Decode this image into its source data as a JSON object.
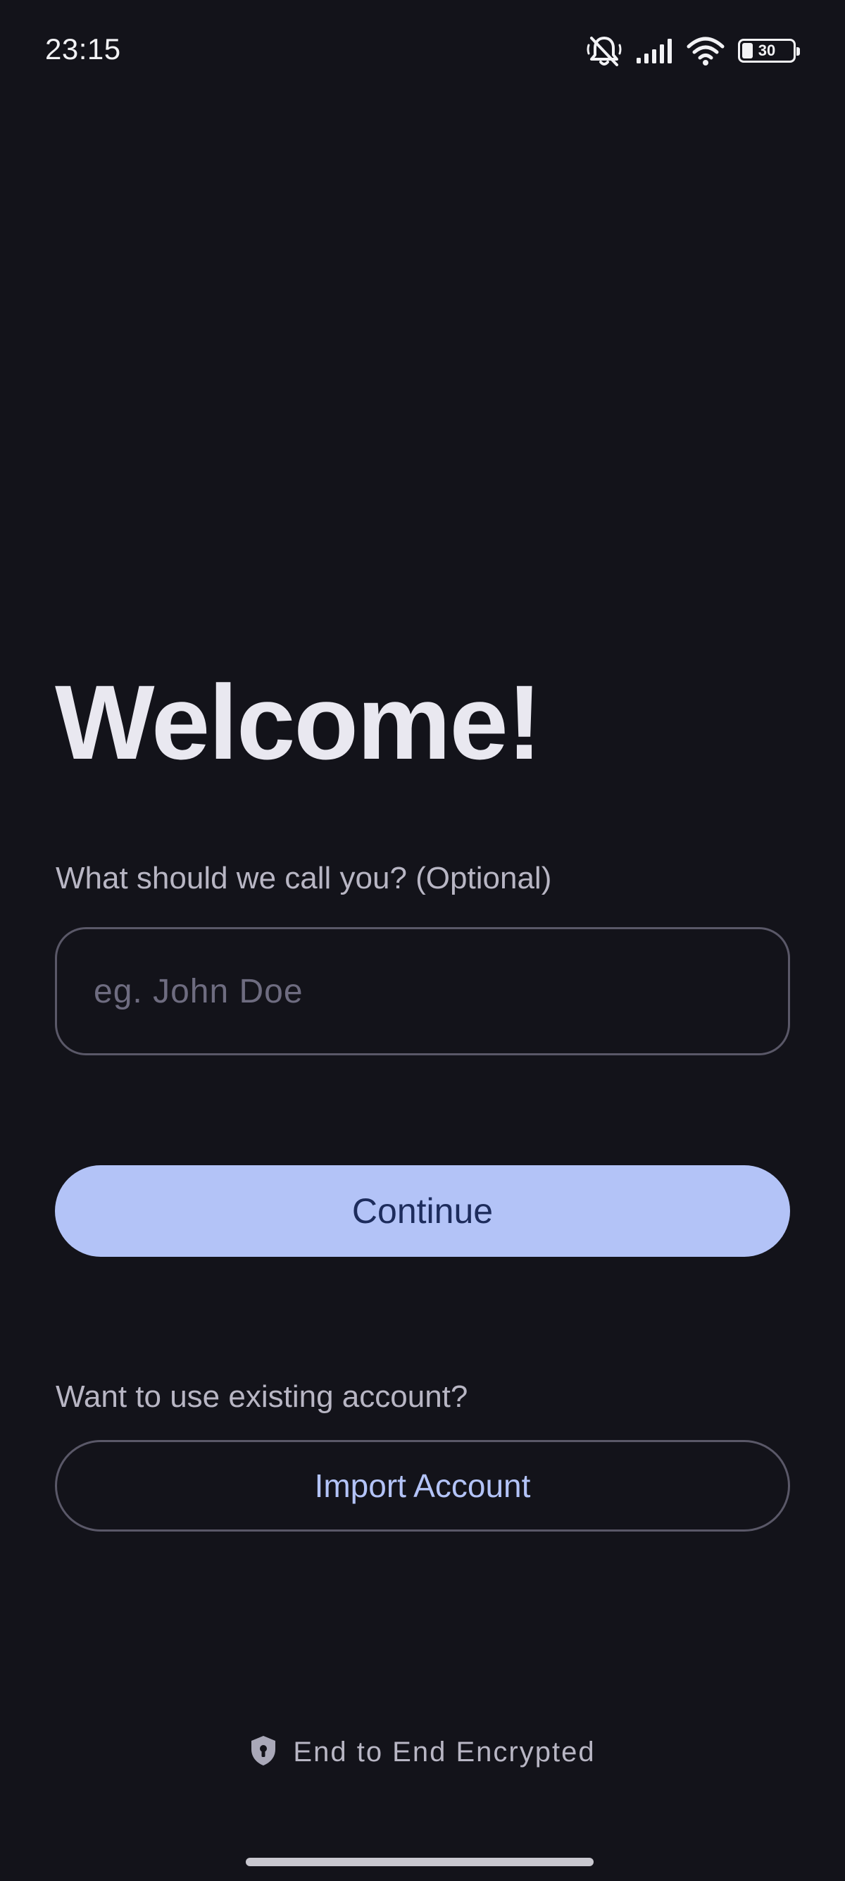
{
  "status_bar": {
    "time": "23:15",
    "battery_level": "30",
    "icons": [
      "bell-off-icon",
      "signal-icon",
      "wifi-icon",
      "battery-icon"
    ]
  },
  "welcome": {
    "title": "Welcome!"
  },
  "name_field": {
    "label": "What should we call you? (Optional)",
    "placeholder": "eg. John Doe",
    "value": ""
  },
  "continue_button": {
    "label": "Continue"
  },
  "import_section": {
    "prompt": "Want to use existing account?",
    "button_label": "Import Account"
  },
  "footer": {
    "encryption_label": "End to End Encrypted",
    "icon": "shield-lock-icon"
  },
  "colors": {
    "background": "#13131a",
    "primary": "#b3c3f7",
    "on_primary": "#1d2c5c",
    "outline": "#5a5868",
    "text_secondary": "#b8b6c4"
  }
}
